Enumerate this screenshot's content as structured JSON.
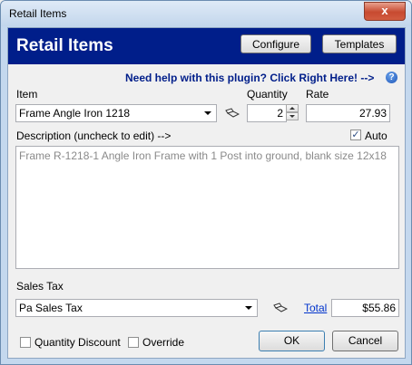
{
  "window": {
    "title": "Retail Items",
    "close_glyph": "x"
  },
  "header": {
    "title": "Retail Items",
    "configure_label": "Configure",
    "templates_label": "Templates"
  },
  "help": {
    "text": "Need help with this plugin?  Click Right Here! -->",
    "icon_glyph": "?"
  },
  "item": {
    "label": "Item",
    "value": "Frame Angle Iron 1218",
    "lookup_icon": "book-icon"
  },
  "quantity": {
    "label": "Quantity",
    "value": "2"
  },
  "rate": {
    "label": "Rate",
    "value": "27.93"
  },
  "description": {
    "label": "Description (uncheck to edit) -->",
    "auto_label": "Auto",
    "auto_checked": true,
    "text": "Frame R-1218-1 Angle Iron Frame with 1 Post into ground, blank size 12x18"
  },
  "sales_tax": {
    "label": "Sales Tax",
    "value": "Pa Sales Tax",
    "lookup_icon": "book-icon"
  },
  "total": {
    "link_label": "Total",
    "value": "$55.86"
  },
  "options": {
    "quantity_discount_label": "Quantity Discount",
    "quantity_discount_checked": false,
    "override_label": "Override",
    "override_checked": false
  },
  "actions": {
    "ok_label": "OK",
    "cancel_label": "Cancel"
  },
  "colors": {
    "header_bg": "#001e8a",
    "help_text": "#001e8a",
    "link": "#0033cc"
  }
}
